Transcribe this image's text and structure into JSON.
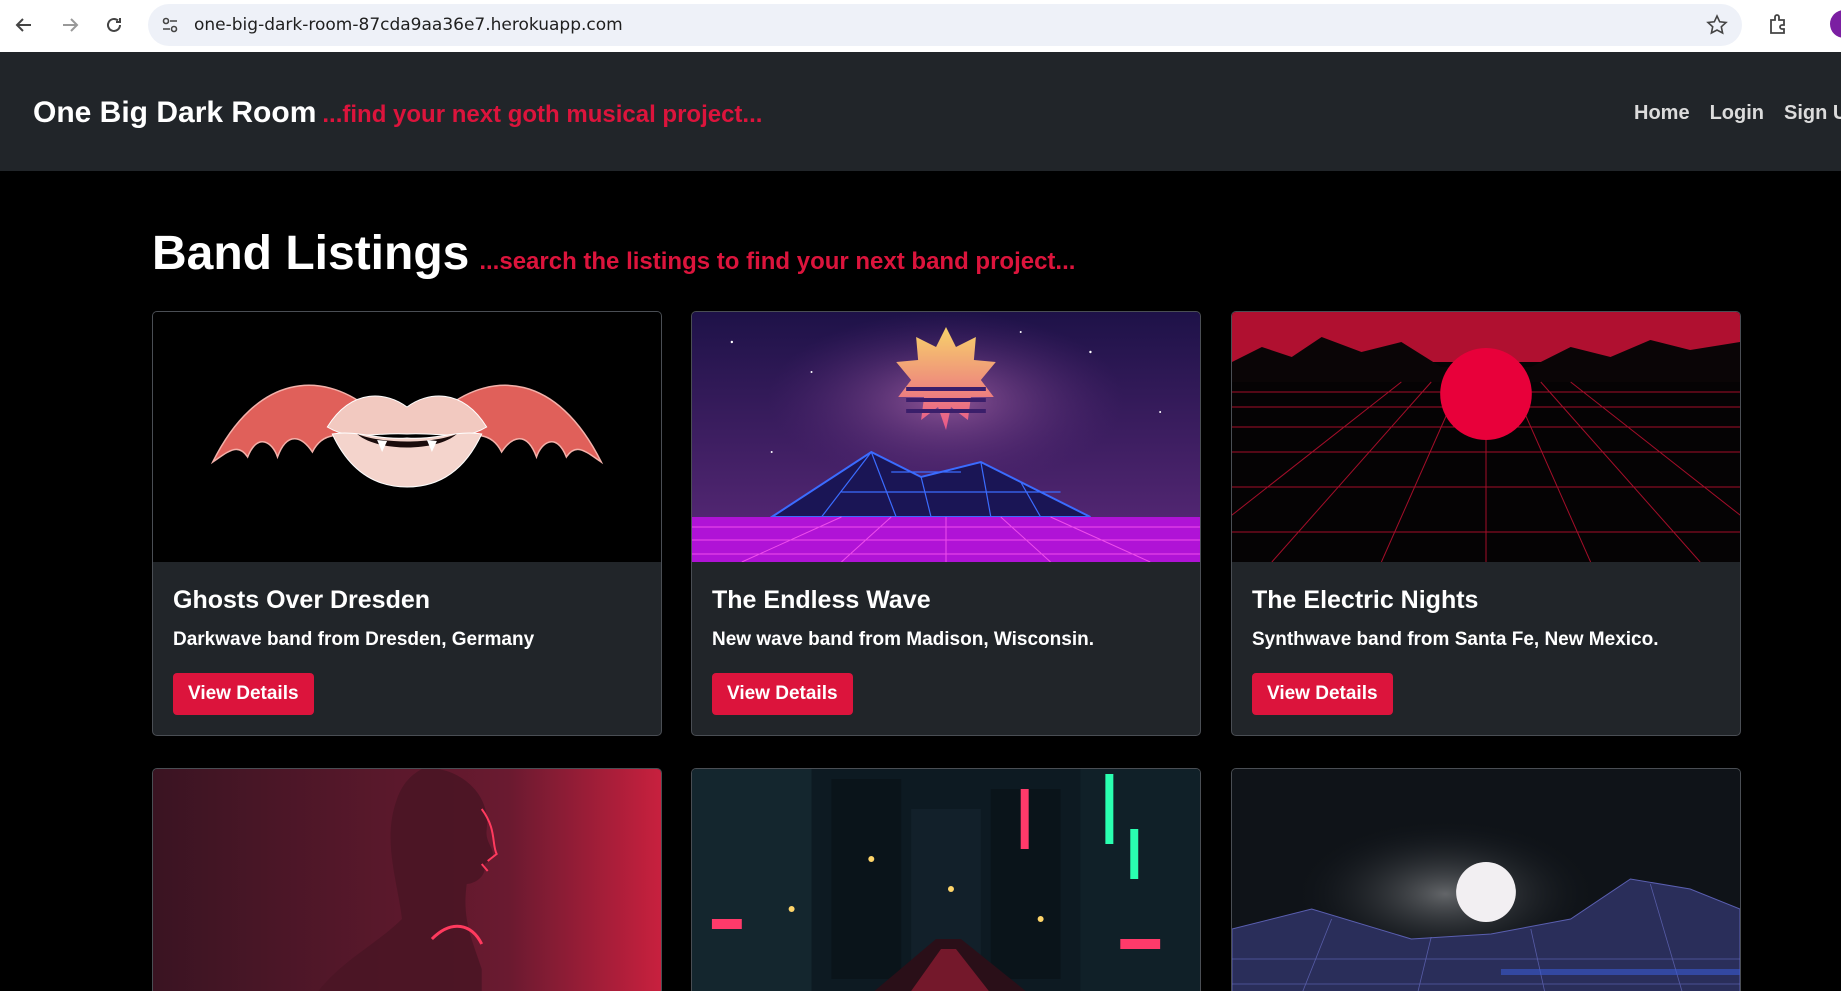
{
  "browser": {
    "url": "one-big-dark-room-87cda9aa36e7.herokuapp.com"
  },
  "header": {
    "brand": "One Big Dark Room",
    "tagline": "...find your next goth musical project...",
    "nav": [
      "Home",
      "Login",
      "Sign U"
    ]
  },
  "main": {
    "title": "Band Listings",
    "subtitle": "...search the listings to find your next band project..."
  },
  "cards": [
    {
      "title": "Ghosts Over Dresden",
      "description": "Darkwave band from Dresden, Germany",
      "button": "View Details",
      "image": "winged-lips"
    },
    {
      "title": "The Endless Wave",
      "description": "New wave band from Madison, Wisconsin.",
      "button": "View Details",
      "image": "synthwave-mountains"
    },
    {
      "title": "The Electric Nights",
      "description": "Synthwave band from Santa Fe, New Mexico.",
      "button": "View Details",
      "image": "red-sun-grid"
    },
    {
      "image": "woman-portrait"
    },
    {
      "image": "neon-city-street"
    },
    {
      "image": "moon-over-wireframe"
    }
  ],
  "colors": {
    "accent": "#dc143c",
    "header_bg": "#212529",
    "card_bg": "#212529",
    "page_bg": "#000000"
  }
}
